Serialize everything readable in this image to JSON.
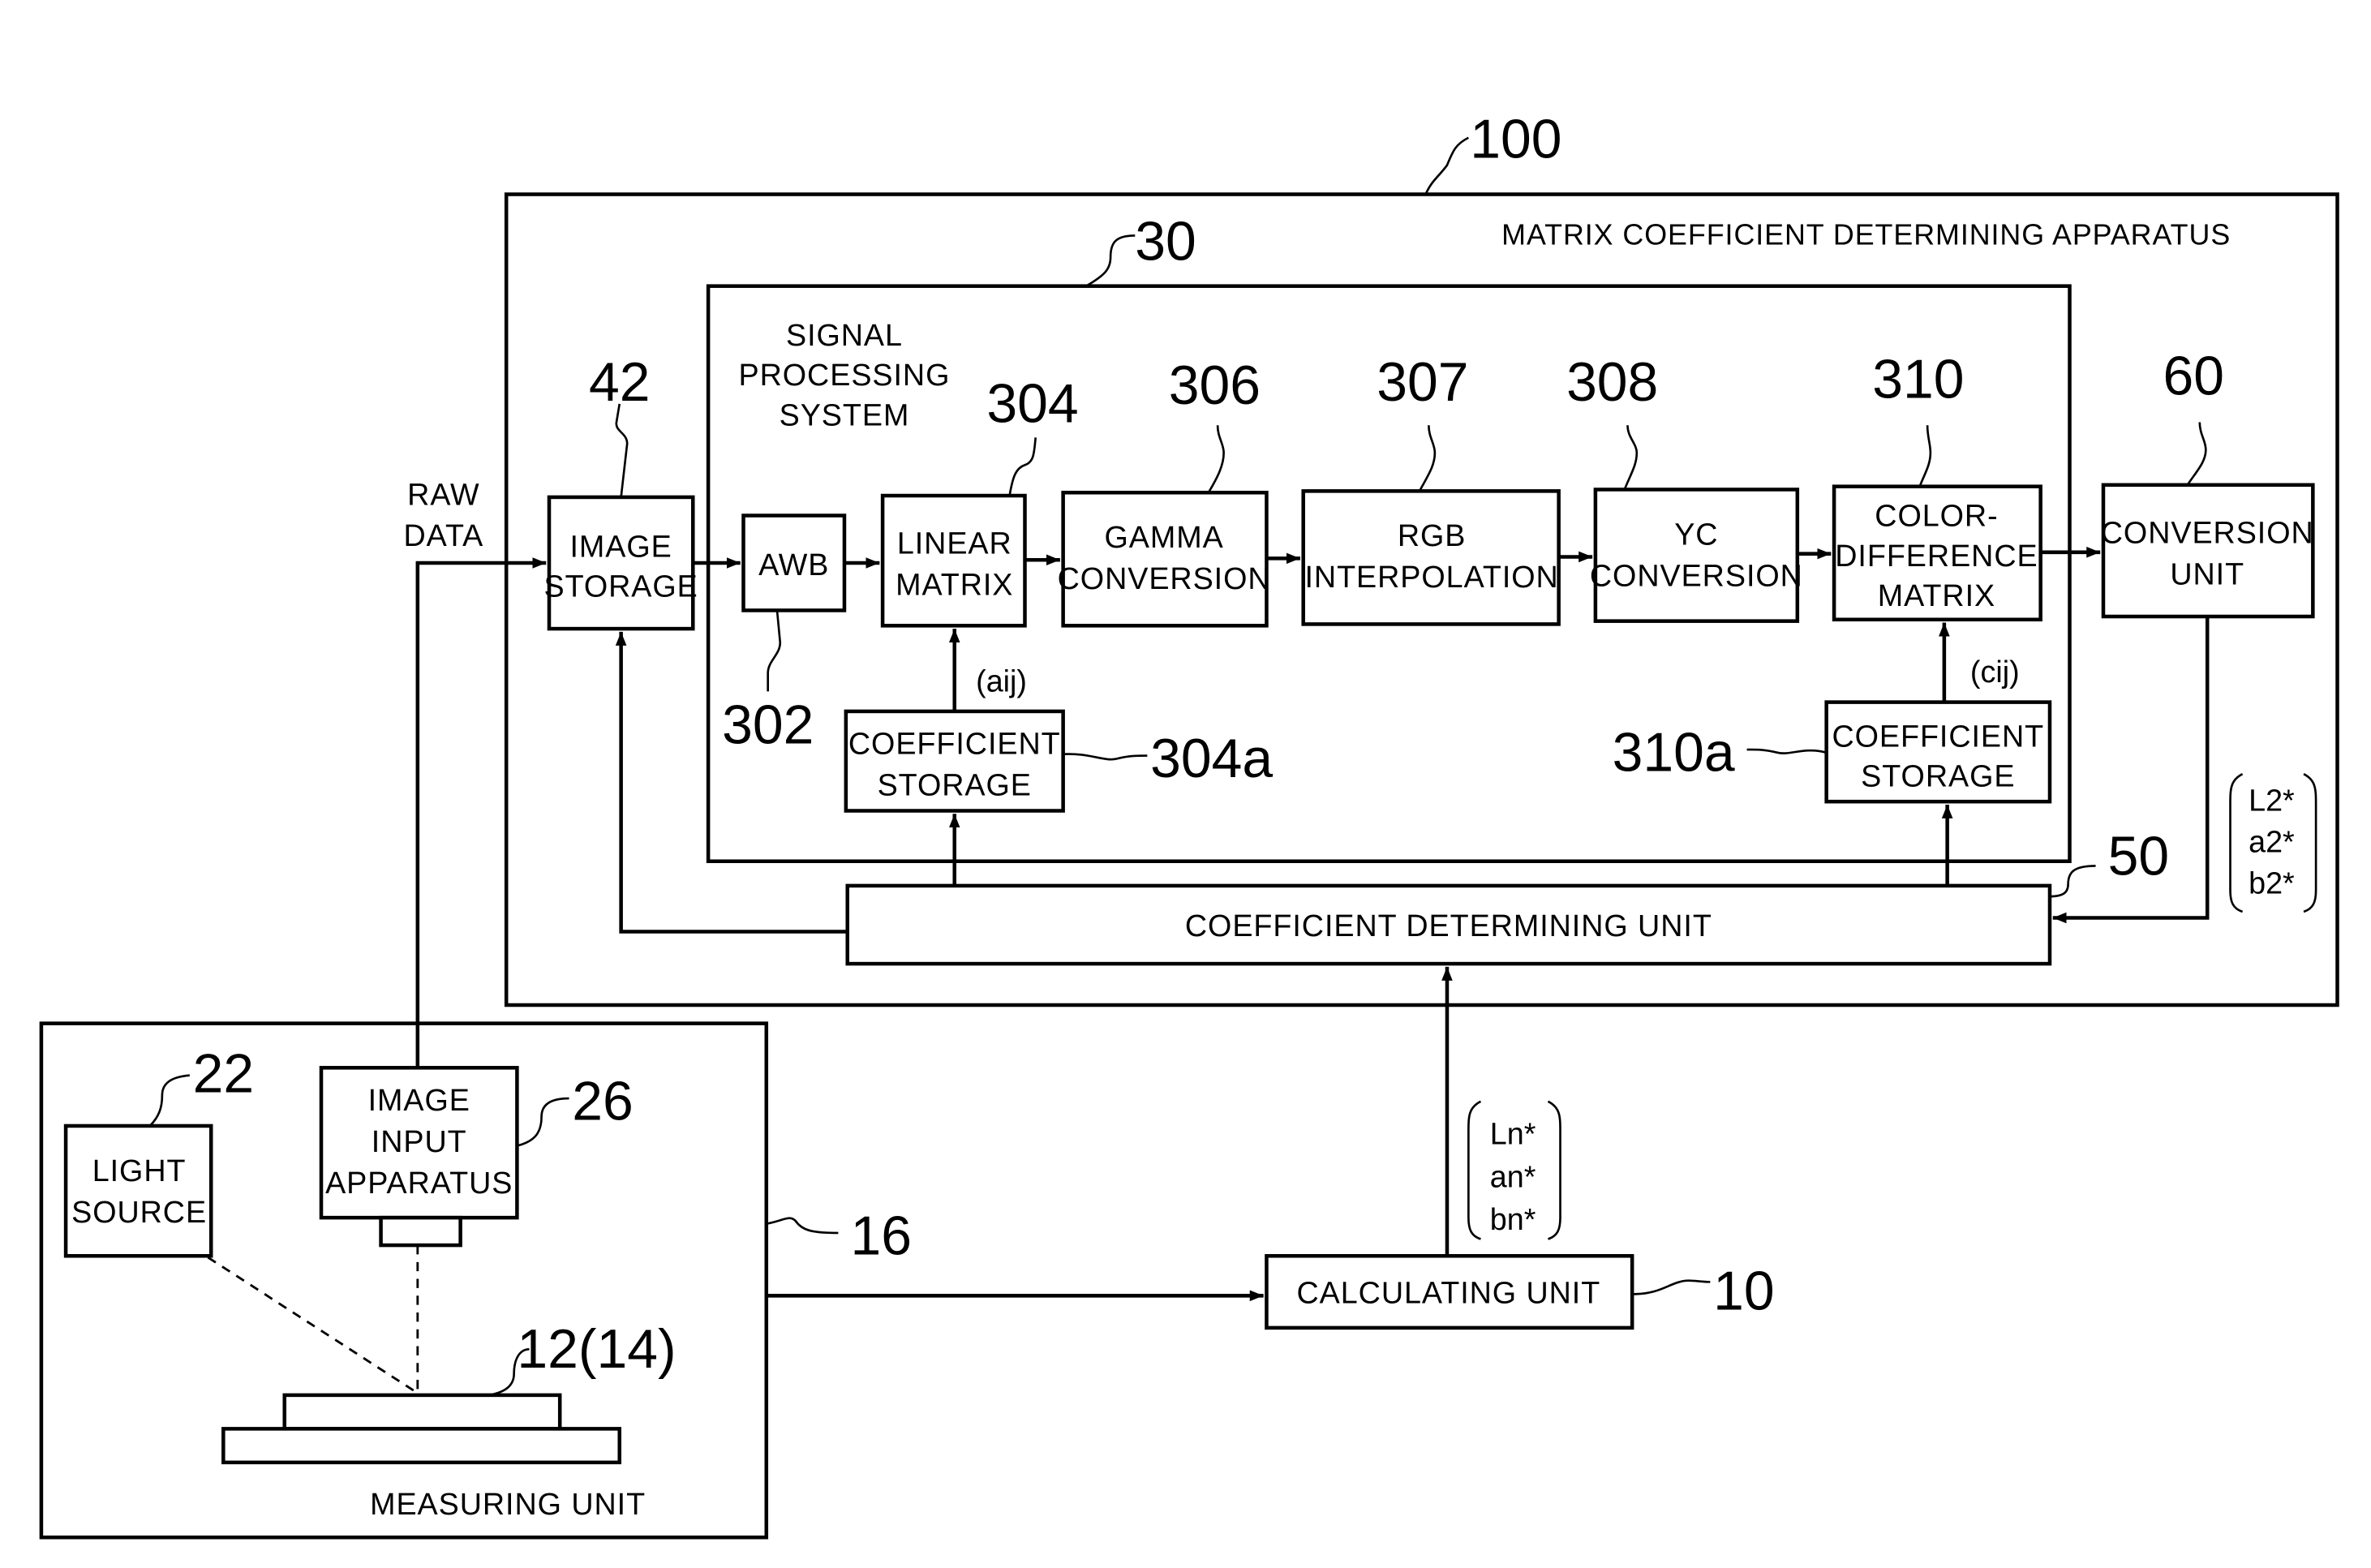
{
  "figure": {
    "apparatus": {
      "ref": "100",
      "title": "MATRIX COEFFICIENT DETERMINING APPARATUS"
    },
    "signal_processing": {
      "ref": "30",
      "title_lines": [
        "SIGNAL",
        "PROCESSING",
        "SYSTEM"
      ]
    },
    "raw_data_label": [
      "RAW",
      "DATA"
    ],
    "blocks": {
      "image_storage": {
        "ref": "42",
        "lines": [
          "IMAGE",
          "STORAGE"
        ]
      },
      "awb": {
        "ref": "302",
        "lines": [
          "AWB"
        ]
      },
      "linear_matrix": {
        "ref": "304",
        "lines": [
          "LINEAR",
          "MATRIX"
        ]
      },
      "gamma_conversion": {
        "ref": "306",
        "lines": [
          "GAMMA",
          "CONVERSION"
        ]
      },
      "rgb_interpolation": {
        "ref": "307",
        "lines": [
          "RGB",
          "INTERPOLATION"
        ]
      },
      "yc_conversion": {
        "ref": "308",
        "lines": [
          "YC",
          "CONVERSION"
        ]
      },
      "color_difference_matrix": {
        "ref": "310",
        "lines": [
          "COLOR-",
          "DIFFERENCE",
          "MATRIX"
        ]
      },
      "conversion_unit": {
        "ref": "60",
        "lines": [
          "CONVERSION",
          "UNIT"
        ]
      },
      "coef_storage_a": {
        "ref": "304a",
        "lines": [
          "COEFFICIENT",
          "STORAGE"
        ],
        "symbol": "(aij)"
      },
      "coef_storage_c": {
        "ref": "310a",
        "lines": [
          "COEFFICIENT",
          "STORAGE"
        ],
        "symbol": "(cij)"
      },
      "coef_determining_unit": {
        "ref": "50",
        "lines": [
          "COEFFICIENT DETERMINING UNIT"
        ]
      },
      "calculating_unit": {
        "ref": "10",
        "lines": [
          "CALCULATING UNIT"
        ]
      },
      "light_source": {
        "ref": "22",
        "lines": [
          "LIGHT",
          "SOURCE"
        ]
      },
      "image_input_apparatus": {
        "ref": "26",
        "lines": [
          "IMAGE",
          "INPUT",
          "APPARATUS"
        ]
      },
      "measuring_unit": {
        "ref": "16",
        "title": "MEASURING UNIT"
      },
      "sample": {
        "ref": "12(14)"
      }
    },
    "vectors": {
      "lab2": [
        "L2*",
        "a2*",
        "b2*"
      ],
      "labn": [
        "Ln*",
        "an*",
        "bn*"
      ]
    }
  }
}
